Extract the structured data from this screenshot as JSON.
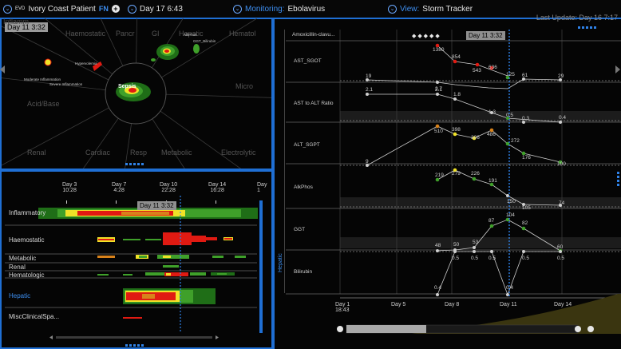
{
  "topbar": {
    "patient_prefix": "EVD",
    "patient_name": "Ivory Coast Patient",
    "patient_badge": "FN",
    "day_time": "Day 17  6:43",
    "monitoring_label": "Monitoring:",
    "monitoring_value": "Ebolavirus",
    "view_label": "View:",
    "view_value": "Storm Tracker",
    "last_update": "Last Update: Day 16  7:17"
  },
  "radar": {
    "time_badge": "Day 11 3:32",
    "sectors": [
      "Haemostatic",
      "Pancr",
      "GI",
      "Hepatic",
      "Hematol",
      "Micro",
      "Electrolytic",
      "Metabolic",
      "Resp",
      "Cardiac",
      "Renal",
      "Acid/Base",
      "Inflamm"
    ],
    "center_label": "Sepsis",
    "blob_labels": [
      "AlkPhos",
      "GGT_Bilirubin",
      "Moderate Inflammation",
      "Severe Inflammation",
      "Hypervolemia"
    ]
  },
  "timeline": {
    "time_badge": "Day 11  3:32",
    "day_ticks": [
      {
        "day": "Day 3",
        "time": "10:28"
      },
      {
        "day": "Day 7",
        "time": "4:28"
      },
      {
        "day": "Day 10",
        "time": "22:28"
      },
      {
        "day": "Day 14",
        "time": "16:28"
      },
      {
        "day": "Day 1",
        "time": ""
      }
    ],
    "rows": [
      {
        "label": "Inflammatory",
        "highlight": false
      },
      {
        "label": "Haemostatic",
        "highlight": false
      },
      {
        "label": "Metabolic",
        "highlight": false
      },
      {
        "label": "Renal",
        "highlight": false
      },
      {
        "label": "Hematologic",
        "highlight": false
      },
      {
        "label": "Hepatic",
        "highlight": true
      },
      {
        "label": "MiscClinicalSpa...",
        "highlight": false
      }
    ],
    "colors": {
      "red": "#e01a12",
      "yellow": "#f0e227",
      "orange": "#d8821b",
      "green": "#3fa02a",
      "darkgreen": "#1f6e17"
    }
  },
  "labs": {
    "medication": "Amoxicillin-clavu...",
    "time_badge": "Day 11 3:32",
    "side_label": "Hepatic",
    "x_ticks": [
      {
        "day": "Day 1",
        "time": "18:43"
      },
      {
        "day": "Day 5",
        "time": ""
      },
      {
        "day": "Day 8",
        "time": ""
      },
      {
        "day": "Day 11",
        "time": ""
      },
      {
        "day": "Day 14",
        "time": ""
      }
    ],
    "rows": [
      {
        "name": "AST_SGOT",
        "values": [
          "19",
          "2.7",
          "1380",
          "854",
          "543",
          "636",
          "125",
          "61",
          "29"
        ]
      },
      {
        "name": "AST to ALT Ratio",
        "values": [
          "2.1",
          "2.1",
          "1.8",
          "1.3",
          "0.5",
          "0.3",
          "0.4"
        ]
      },
      {
        "name": "ALT_SGPT",
        "values": [
          "9",
          "510",
          "398",
          "306",
          "486",
          "272",
          "176",
          "100"
        ]
      },
      {
        "name": "AlkPhos",
        "values": [
          "219",
          "279",
          "226",
          "191",
          "150",
          "105",
          "74"
        ]
      },
      {
        "name": "GGT",
        "values": [
          "48",
          "50",
          "53",
          "87",
          "104",
          "82",
          "60"
        ]
      },
      {
        "name": "Bilirubin",
        "values": [
          "0.5",
          "0.5",
          "0.5",
          "0.5",
          "0.5",
          "0.5",
          "0.4",
          "0.4"
        ]
      }
    ],
    "colors": {
      "gray": "#cfcfcf",
      "green": "#3fa02a",
      "red": "#e01a12",
      "yellow": "#f0e227",
      "orange": "#d8821b",
      "olive": "#3a3510"
    }
  }
}
